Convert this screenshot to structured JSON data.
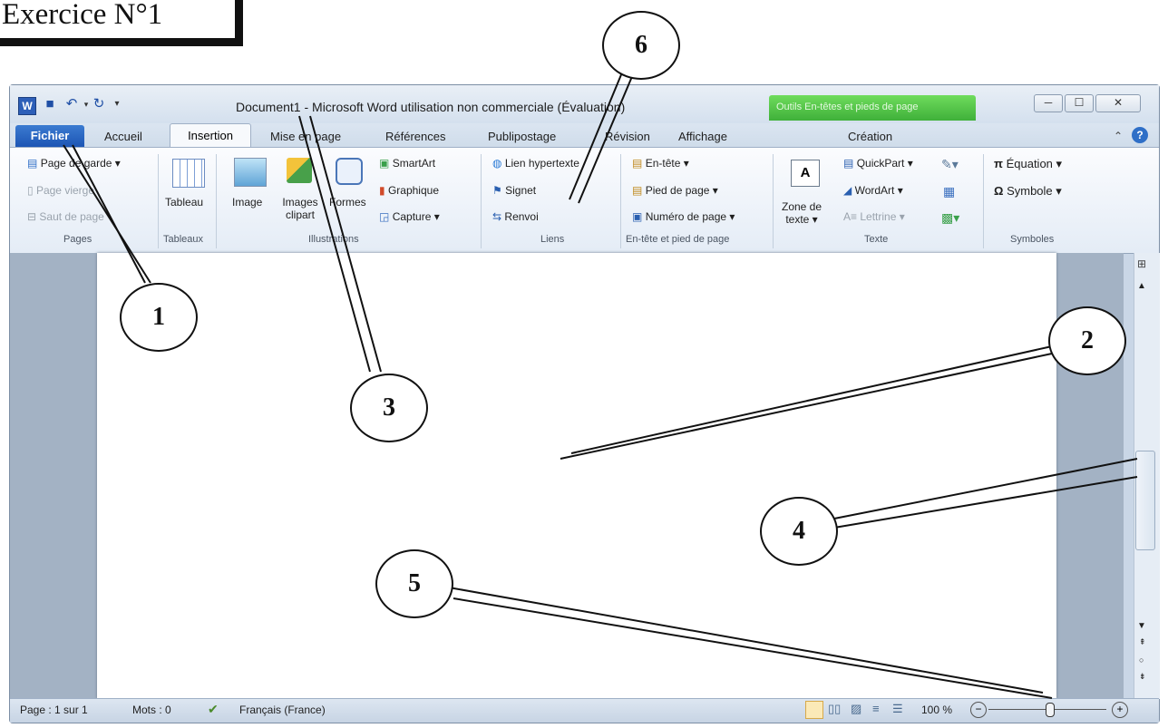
{
  "exercise": {
    "title": "Exercice N°1"
  },
  "window": {
    "title": "Document1 - Microsoft Word utilisation non commerciale (Évaluation)",
    "context_tab": "Outils En-têtes et pieds de page",
    "minimize": "─",
    "maximize": "☐",
    "close": "✕"
  },
  "tabs": {
    "file": "Fichier",
    "items": [
      "Accueil",
      "Insertion",
      "Mise en page",
      "Références",
      "Publipostage",
      "Révision",
      "Affichage"
    ],
    "context": "Création"
  },
  "ribbon": {
    "pages": {
      "cover": "Page de garde ▾",
      "blank": "Page vierge",
      "break": "Saut de page",
      "label": "Pages"
    },
    "tables": {
      "table": "Tableau",
      "label": "Tableaux"
    },
    "illustrations": {
      "image": "Image",
      "clipart": "Images clipart",
      "shapes": "Formes",
      "smartart": "SmartArt",
      "chart": "Graphique",
      "capture": "Capture ▾",
      "label": "Illustrations"
    },
    "links": {
      "hyperlink": "Lien hypertexte",
      "bookmark": "Signet",
      "crossref": "Renvoi",
      "label": "Liens"
    },
    "header_footer": {
      "header": "En-tête ▾",
      "footer": "Pied de page ▾",
      "page_number": "Numéro de page ▾",
      "label": "En-tête et pied de page"
    },
    "text": {
      "textbox_1": "Zone de",
      "textbox_2": "texte ▾",
      "quickpart": "QuickPart ▾",
      "wordart": "WordArt ▾",
      "dropcap": "Lettrine ▾",
      "label": "Texte"
    },
    "symbols": {
      "equation": "Équation ▾",
      "symbol": "Symbole ▾",
      "label": "Symboles"
    }
  },
  "status": {
    "page": "Page : 1 sur 1",
    "words": "Mots : 0",
    "language": "Français (France)",
    "zoom": "100 %"
  },
  "callouts": [
    "1",
    "2",
    "3",
    "4",
    "5",
    "6"
  ]
}
